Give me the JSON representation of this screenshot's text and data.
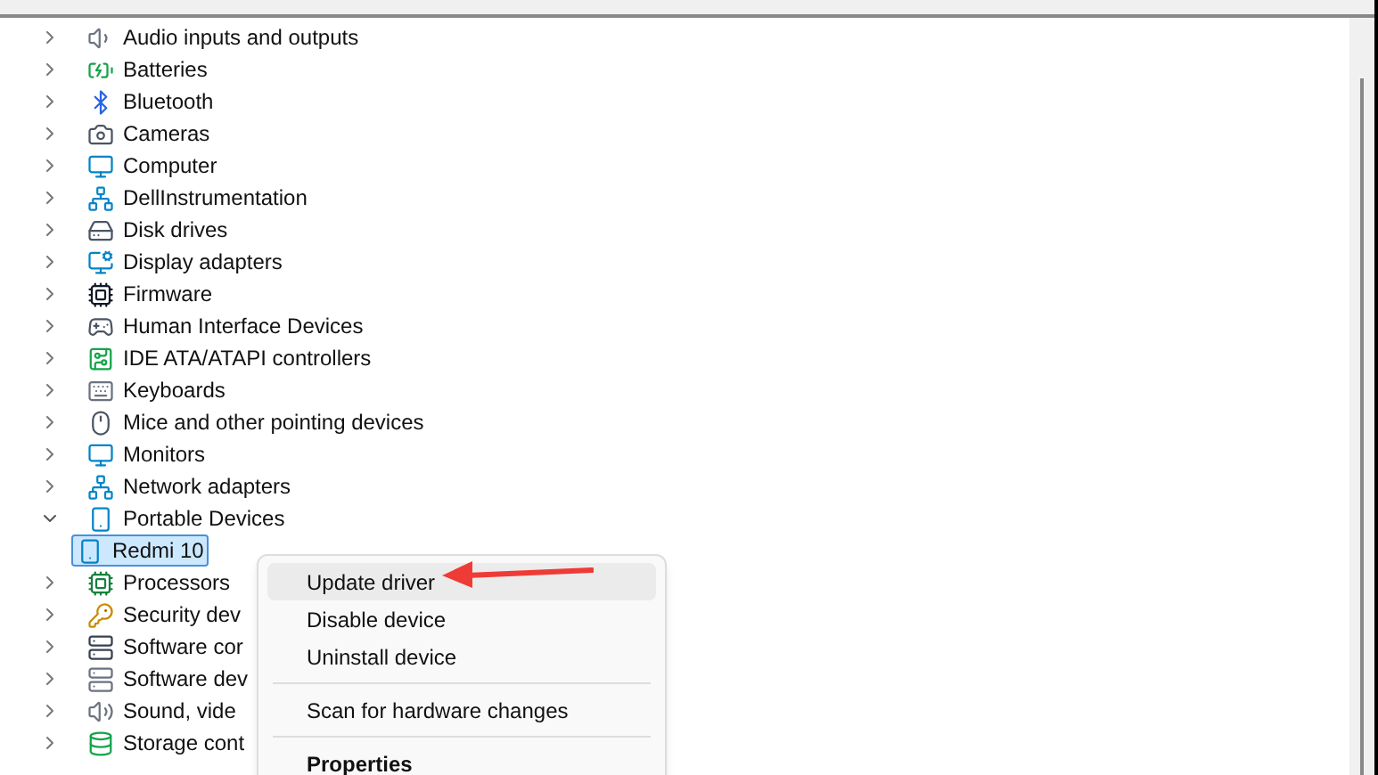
{
  "tree": {
    "items": [
      {
        "label": "Audio inputs and outputs",
        "expanded": false,
        "selected": false
      },
      {
        "label": "Batteries",
        "expanded": false,
        "selected": false
      },
      {
        "label": "Bluetooth",
        "expanded": false,
        "selected": false
      },
      {
        "label": "Cameras",
        "expanded": false,
        "selected": false
      },
      {
        "label": "Computer",
        "expanded": false,
        "selected": false
      },
      {
        "label": "DellInstrumentation",
        "expanded": false,
        "selected": false
      },
      {
        "label": "Disk drives",
        "expanded": false,
        "selected": false
      },
      {
        "label": "Display adapters",
        "expanded": false,
        "selected": false
      },
      {
        "label": "Firmware",
        "expanded": false,
        "selected": false
      },
      {
        "label": "Human Interface Devices",
        "expanded": false,
        "selected": false
      },
      {
        "label": "IDE ATA/ATAPI controllers",
        "expanded": false,
        "selected": false
      },
      {
        "label": "Keyboards",
        "expanded": false,
        "selected": false
      },
      {
        "label": "Mice and other pointing devices",
        "expanded": false,
        "selected": false
      },
      {
        "label": "Monitors",
        "expanded": false,
        "selected": false
      },
      {
        "label": "Network adapters",
        "expanded": false,
        "selected": false
      },
      {
        "label": "Portable Devices",
        "expanded": true,
        "selected": false,
        "children": [
          {
            "label": "Redmi 10",
            "selected": true
          }
        ]
      },
      {
        "label": "Processors",
        "expanded": false,
        "selected": false
      },
      {
        "label": "Security dev",
        "expanded": false,
        "selected": false
      },
      {
        "label": "Software cor",
        "expanded": false,
        "selected": false
      },
      {
        "label": "Software dev",
        "expanded": false,
        "selected": false
      },
      {
        "label": "Sound, vide",
        "expanded": false,
        "selected": false
      },
      {
        "label": "Storage cont",
        "expanded": false,
        "selected": false
      }
    ]
  },
  "context_menu": {
    "items": [
      {
        "kind": "command",
        "label": "Update driver",
        "selected": true,
        "default": false
      },
      {
        "kind": "command",
        "label": "Disable device",
        "selected": false,
        "default": false
      },
      {
        "kind": "command",
        "label": "Uninstall device",
        "selected": false,
        "default": false
      },
      {
        "kind": "separator"
      },
      {
        "kind": "command",
        "label": "Scan for hardware changes",
        "selected": false,
        "default": false
      },
      {
        "kind": "separator"
      },
      {
        "kind": "command",
        "label": "Properties",
        "selected": false,
        "default": true
      }
    ]
  }
}
